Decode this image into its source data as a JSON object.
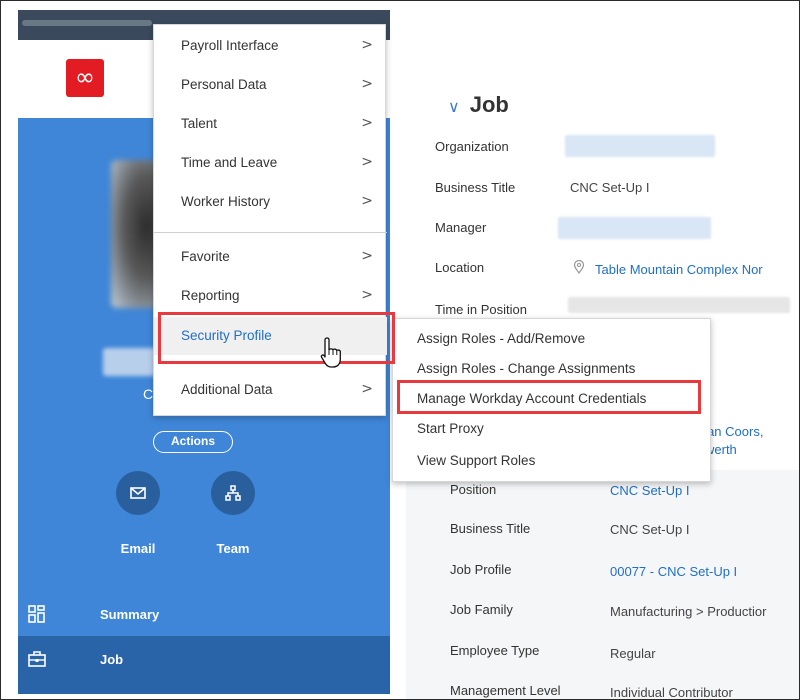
{
  "header": {
    "logo_glyph": "∞"
  },
  "worker": {
    "id_char": "C",
    "actions_label": "Actions",
    "email_label": "Email",
    "team_label": "Team"
  },
  "nav": {
    "summary_label": "Summary",
    "job_label": "Job"
  },
  "menu": {
    "items": [
      {
        "label": "Payroll Interface"
      },
      {
        "label": "Personal Data"
      },
      {
        "label": "Talent"
      },
      {
        "label": "Time and Leave"
      },
      {
        "label": "Worker History"
      },
      {
        "label": "Favorite"
      },
      {
        "label": "Reporting"
      },
      {
        "label": "Security Profile",
        "active": true
      },
      {
        "label": "Additional Data"
      }
    ],
    "arrow": ">"
  },
  "submenu": {
    "items": [
      {
        "label": "Assign Roles - Add/Remove"
      },
      {
        "label": "Assign Roles - Change Assignments"
      },
      {
        "label": "Manage Workday Account Credentials",
        "highlighted": true
      },
      {
        "label": "Start Proxy"
      },
      {
        "label": "View Support Roles"
      }
    ]
  },
  "job": {
    "chevron": "∨",
    "title": "Job",
    "organization_label": "Organization",
    "business_title_label": "Business Title",
    "business_title_value": "CNC Set-Up I",
    "manager_label": "Manager",
    "location_label": "Location",
    "location_value": "Table Mountain Complex Nor",
    "time_in_position_label": "Time in Position",
    "partial_link_1": "athan Coors,",
    "partial_link_2": "werth",
    "position_label": "Position",
    "position_value": "CNC Set-Up I",
    "business_title_label_2": "Business Title",
    "business_title_value_2": "CNC Set-Up I",
    "job_profile_label": "Job Profile",
    "job_profile_value": "00077 - CNC Set-Up I",
    "job_family_label": "Job Family",
    "job_family_value": "Manufacturing > Productior",
    "employee_type_label": "Employee Type",
    "employee_type_value": "Regular",
    "management_level_label": "Management Level",
    "management_level_value": "Individual Contributor"
  },
  "colors": {
    "accent_blue": "#3f86d8",
    "link_blue": "#1f6fc5",
    "highlight_red": "#e8393f",
    "logo_red": "#e31b23"
  }
}
